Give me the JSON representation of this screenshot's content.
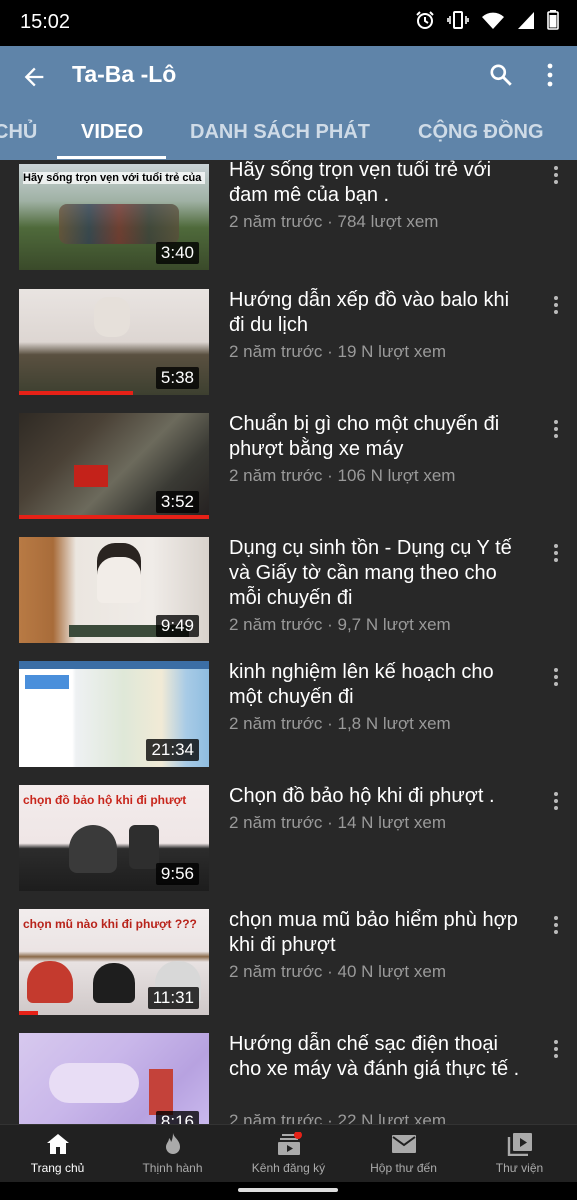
{
  "status_bar": {
    "time": "15:02"
  },
  "app_bar": {
    "title": "Ta-Ba -Lô",
    "tabs": [
      {
        "label": "CHỦ",
        "active": false
      },
      {
        "label": "VIDEO",
        "active": true
      },
      {
        "label": "DANH SÁCH PHÁT",
        "active": false
      },
      {
        "label": "CỘNG ĐỒNG",
        "active": false
      }
    ]
  },
  "videos": [
    {
      "title": "Hãy sống trọn vẹn tuổi trẻ với đam mê của bạn .",
      "meta": "2 năm trước · 784 lượt xem",
      "duration": "3:40",
      "thumb_caption": "Hãy sống trọn vẹn với tuổi trẻ của bạn",
      "watched": 0
    },
    {
      "title": "Hướng dẫn xếp đồ vào balo khi đi du lịch",
      "meta": "2 năm trước · 19 N lượt xem",
      "duration": "5:38",
      "thumb_caption": "",
      "watched": 0.6
    },
    {
      "title": "Chuẩn bị gì cho một chuyến đi phượt bằng xe máy",
      "meta": "2 năm trước · 106 N lượt xem",
      "duration": "3:52",
      "thumb_caption": "",
      "watched": 1
    },
    {
      "title": "Dụng cụ sinh tồn - Dụng cụ Y tế và Giấy tờ cần mang theo cho mỗi chuyến đi",
      "meta": "2 năm trước · 9,7 N lượt xem",
      "duration": "9:49",
      "thumb_caption": "",
      "watched": 0
    },
    {
      "title": "kinh nghiệm lên kế hoạch cho một chuyến đi",
      "meta": "2 năm trước · 1,8 N lượt xem",
      "duration": "21:34",
      "thumb_caption": "",
      "watched": 0
    },
    {
      "title": "Chọn đồ bảo hộ khi đi phượt .",
      "meta": "2 năm trước · 14 N lượt xem",
      "duration": "9:56",
      "thumb_caption": "chọn đồ bảo hộ khi đi phượt",
      "watched": 0
    },
    {
      "title": "chọn mua mũ bảo hiểm phù hợp khi đi phượt",
      "meta": "2 năm trước · 40 N lượt xem",
      "duration": "11:31",
      "thumb_caption": "chọn mũ nào khi đi phượt ???",
      "watched": 0.1
    },
    {
      "title": "Hướng dẫn chế sạc điện thoại cho xe máy và đánh giá thực tế .",
      "meta": "2 năm trước · 22 N lượt xem",
      "duration": "8:16",
      "thumb_caption": "",
      "watched": 0
    }
  ],
  "bottom_nav": [
    {
      "label": "Trang chủ",
      "icon": "home-icon",
      "active": true
    },
    {
      "label": "Thịnh hành",
      "icon": "flame-icon",
      "active": false
    },
    {
      "label": "Kênh đăng ký",
      "icon": "subscriptions-icon",
      "active": false
    },
    {
      "label": "Hộp thư đến",
      "icon": "inbox-icon",
      "active": false
    },
    {
      "label": "Thư viện",
      "icon": "library-icon",
      "active": false
    }
  ],
  "colors": {
    "app_bar": "#5f84a9",
    "background": "#282828",
    "accent_red": "#e62117"
  }
}
